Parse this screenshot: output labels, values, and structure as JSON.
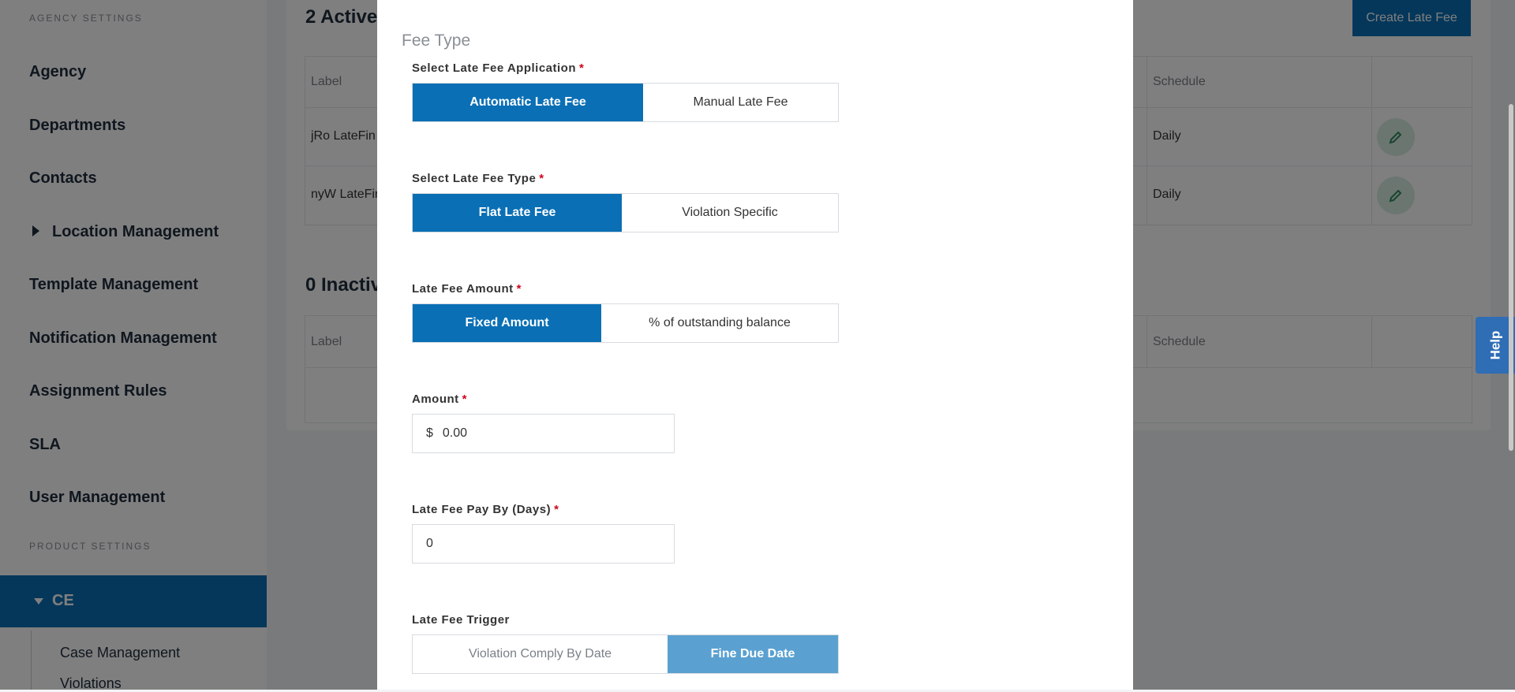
{
  "sidebar": {
    "agency_settings_heading": "AGENCY SETTINGS",
    "items": [
      {
        "label": "Agency"
      },
      {
        "label": "Departments"
      },
      {
        "label": "Contacts"
      },
      {
        "label": "Location Management"
      },
      {
        "label": "Template Management"
      },
      {
        "label": "Notification Management"
      },
      {
        "label": "Assignment Rules"
      },
      {
        "label": "SLA"
      },
      {
        "label": "User Management"
      }
    ],
    "product_settings_heading": "PRODUCT SETTINGS",
    "active_group": "CE",
    "sub_items": [
      {
        "label": "Case Management"
      },
      {
        "label": "Violations"
      }
    ]
  },
  "main": {
    "active_title": "2 Active",
    "inactive_title": "0 Inactiv",
    "create_button": "Create Late Fee",
    "active_table": {
      "headers": {
        "label": "Label",
        "schedule": "Schedule"
      },
      "rows": [
        {
          "label": "jRo LateFin",
          "schedule": "Daily"
        },
        {
          "label": "nyW LateFin",
          "schedule": "Daily"
        }
      ]
    },
    "inactive_table": {
      "headers": {
        "label": "Label",
        "schedule": "Schedule"
      }
    }
  },
  "help": {
    "label": "Help"
  },
  "modal": {
    "section_title": "Fee Type",
    "application": {
      "label": "Select Late Fee Application",
      "required": "*",
      "options": [
        "Automatic Late Fee",
        "Manual Late Fee"
      ],
      "selected": "Automatic Late Fee"
    },
    "type": {
      "label": "Select Late Fee Type",
      "required": "*",
      "options": [
        "Flat Late Fee",
        "Violation Specific"
      ],
      "selected": "Flat Late Fee"
    },
    "amount_type": {
      "label": "Late Fee Amount",
      "required": "*",
      "options": [
        "Fixed Amount",
        "% of outstanding balance"
      ],
      "selected": "Fixed Amount"
    },
    "amount": {
      "label": "Amount",
      "required": "*",
      "prefix": "$",
      "value": "0.00"
    },
    "pay_by": {
      "label": "Late Fee Pay By (Days)",
      "required": "*",
      "value": "0"
    },
    "trigger": {
      "label": "Late Fee Trigger",
      "options": [
        "Violation Comply By Date",
        "Fine Due Date"
      ],
      "selected": "Fine Due Date"
    }
  },
  "colors": {
    "primary": "#0a6fb5",
    "primary_light": "#5aa1d1",
    "required": "#d0021b",
    "help_tab": "#2f6db5"
  }
}
